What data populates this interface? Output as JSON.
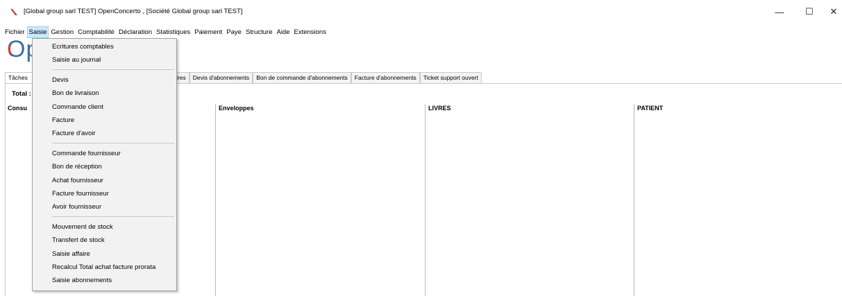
{
  "window": {
    "title": "[Global group sarl TEST] OpenConcerto , [Société Global group sarl TEST]",
    "minimize_symbol": "—",
    "maximize_symbol": "☐",
    "close_symbol": "✕"
  },
  "menubar": {
    "items": [
      "Fichier",
      "Saisie",
      "Gestion",
      "Comptabilité",
      "Déclaration",
      "Statistiques",
      "Paiement",
      "Paye",
      "Structure",
      "Aide",
      "Extensions"
    ],
    "active": "Saisie"
  },
  "logo": {
    "text": "Op"
  },
  "tabs": [
    "Tâches",
    "ires",
    "Devis d'abonnements",
    "Bon de commande d'abonnements",
    "Facture d'abonnements",
    "Ticket support ouvert"
  ],
  "main": {
    "total_label": "Total :",
    "columns": [
      "Consu",
      "Enveloppes",
      "LIVRES",
      "PATIENT"
    ]
  },
  "saisie_menu": {
    "groups": [
      [
        "Ecritures comptables",
        "Saisie au journal"
      ],
      [
        "Devis",
        "Bon de livraison",
        "Commande client",
        "Facture",
        "Facture d'avoir"
      ],
      [
        "Commande fournisseur",
        "Bon de réception",
        "Achat fournisseur",
        "Facture fournisseur",
        "Avoir fournisseur"
      ],
      [
        "Mouvement de stock",
        "Transfert de stock",
        "Saisie affaire",
        "Recalcul Total achat facture prorata",
        "Saisie abonnements"
      ]
    ]
  },
  "colors": {
    "menu_highlight": "#cce8ff",
    "logo_blue": "#3d6ea0",
    "logo_red": "#d4432e"
  }
}
